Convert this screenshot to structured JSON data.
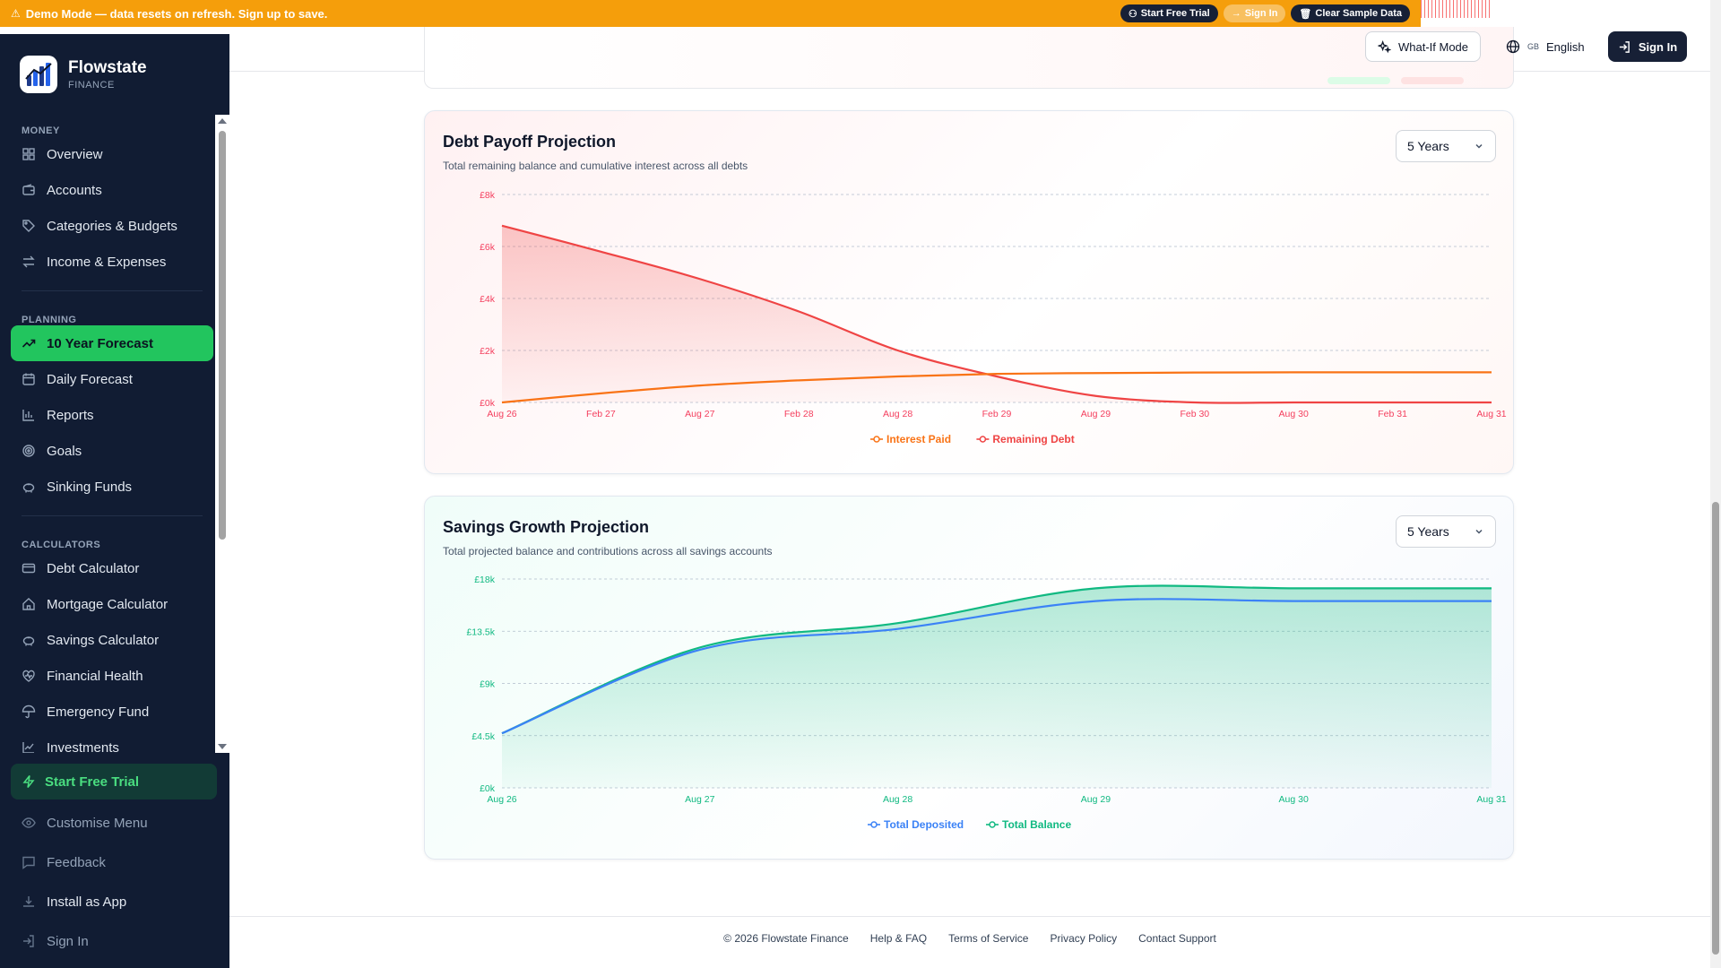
{
  "banner": {
    "text": "Demo Mode — data resets on refresh. Sign up to save.",
    "start_trial": "Start Free Trial",
    "sign_in": "Sign In",
    "clear_data": "Clear Sample Data"
  },
  "brand": {
    "name": "Flowstate",
    "sub": "FINANCE"
  },
  "sidebar": {
    "sections": [
      {
        "label": "MONEY",
        "items": [
          "Overview",
          "Accounts",
          "Categories & Budgets",
          "Income & Expenses"
        ]
      },
      {
        "label": "PLANNING",
        "items": [
          "10 Year Forecast",
          "Daily Forecast",
          "Reports",
          "Goals",
          "Sinking Funds"
        ]
      },
      {
        "label": "CALCULATORS",
        "items": [
          "Debt Calculator",
          "Mortgage Calculator",
          "Savings Calculator",
          "Financial Health",
          "Emergency Fund",
          "Investments"
        ]
      }
    ],
    "active": "10 Year Forecast",
    "bottom": {
      "trial": "Start Free Trial",
      "customise": "Customise Menu",
      "feedback": "Feedback",
      "install": "Install as App",
      "signin": "Sign In"
    }
  },
  "header": {
    "whatif": "What-If Mode",
    "lang_flag": "GB",
    "lang": "English",
    "signin": "Sign In"
  },
  "debt": {
    "title": "Debt Payoff Projection",
    "subtitle": "Total remaining balance and cumulative interest across all debts",
    "range": "5 Years"
  },
  "savings": {
    "title": "Savings Growth Projection",
    "subtitle": "Total projected balance and contributions across all savings accounts",
    "range": "5 Years"
  },
  "colors": {
    "debt_line": "#ef4444",
    "interest_line": "#f97316",
    "balance_line": "#10b981",
    "deposited_line": "#3b82f6",
    "accent": "#22c55e",
    "sidebar_bg": "#111c33"
  },
  "chart_data": [
    {
      "type": "area",
      "title": "Debt Payoff Projection",
      "categories": [
        "Aug 26",
        "Feb 27",
        "Aug 27",
        "Feb 28",
        "Aug 28",
        "Feb 29",
        "Aug 29",
        "Feb 30",
        "Aug 30",
        "Feb 31",
        "Aug 31"
      ],
      "yticks": [
        "£0k",
        "£2k",
        "£4k",
        "£6k",
        "£8k"
      ],
      "ylim": [
        0,
        8000
      ],
      "series": [
        {
          "name": "Interest Paid",
          "values": [
            0,
            350,
            650,
            850,
            1000,
            1100,
            1130,
            1150,
            1160,
            1160,
            1160
          ]
        },
        {
          "name": "Remaining Debt",
          "values": [
            6800,
            5800,
            4750,
            3500,
            2000,
            1000,
            250,
            0,
            0,
            0,
            0
          ]
        }
      ],
      "legend": "bottom",
      "grid": true
    },
    {
      "type": "area",
      "title": "Savings Growth Projection",
      "categories": [
        "Aug 26",
        "Aug 27",
        "Aug 28",
        "Aug 29",
        "Aug 30",
        "Aug 31"
      ],
      "yticks": [
        "£0k",
        "£4.5k",
        "£9k",
        "£13.5k",
        "£18k"
      ],
      "ylim": [
        0,
        18000
      ],
      "series": [
        {
          "name": "Total Deposited",
          "values": [
            4700,
            11900,
            13700,
            16100,
            16100,
            16100
          ]
        },
        {
          "name": "Total Balance",
          "values": [
            4700,
            12100,
            14200,
            17200,
            17200,
            17200
          ]
        }
      ],
      "legend": "bottom",
      "grid": true
    }
  ],
  "footer": {
    "copyright": "© 2026 Flowstate Finance",
    "help": "Help & FAQ",
    "terms": "Terms of Service",
    "privacy": "Privacy Policy",
    "contact": "Contact Support"
  }
}
